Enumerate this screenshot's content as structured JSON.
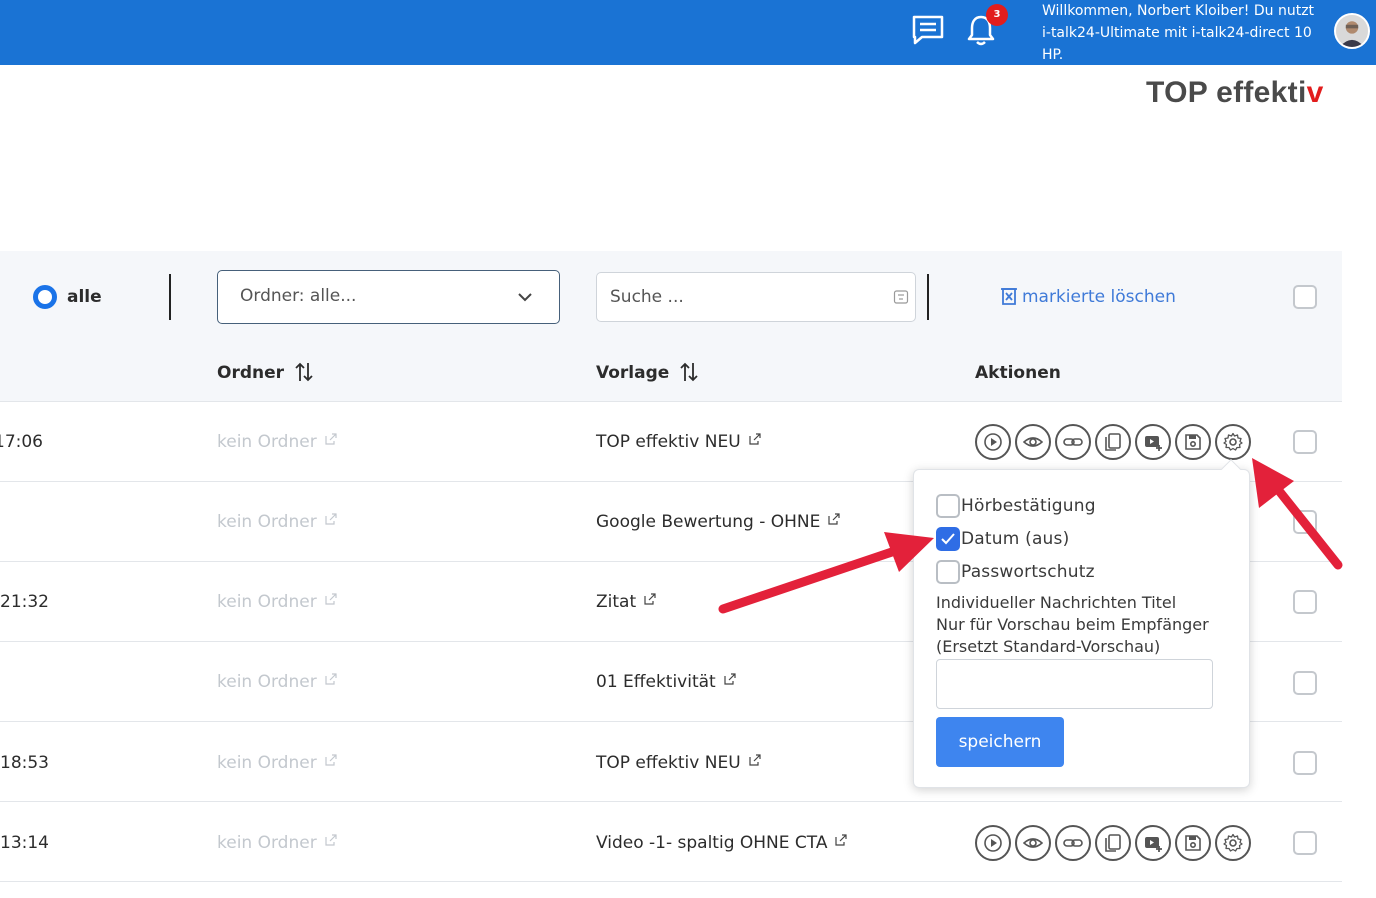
{
  "topbar": {
    "notification_count": "3",
    "welcome_text": "Willkommen, Norbert Kloiber! Du nutzt i-talk24-Ultimate mit i-talk24-direct 10 HP."
  },
  "brand": {
    "part1": "TOP effekti",
    "part2": "v"
  },
  "filters": {
    "radio_label": "alle",
    "folder_select": "Ordner: alle...",
    "search_placeholder": "Suche ...",
    "delete_marked": "markierte löschen"
  },
  "table": {
    "headers": {
      "folder": "Ordner",
      "template": "Vorlage",
      "actions": "Aktionen"
    },
    "rows": [
      {
        "time": "17:06",
        "folder": "kein Ordner",
        "template": "TOP effektiv NEU"
      },
      {
        "time": "",
        "folder": "kein Ordner",
        "template": "Google Bewertung - OHNE"
      },
      {
        "time": "21:32",
        "folder": "kein Ordner",
        "template": "Zitat"
      },
      {
        "time": "",
        "folder": "kein Ordner",
        "template": "01 Effektivität"
      },
      {
        "time": "18:53",
        "folder": "kein Ordner",
        "template": "TOP effektiv NEU"
      },
      {
        "time": "13:14",
        "folder": "kein Ordner",
        "template": "Video -1- spaltig OHNE CTA"
      }
    ]
  },
  "popover": {
    "opt1": "Hörbestätigung",
    "opt2": "Datum (aus)",
    "opt3": "Passwortschutz",
    "opt2_checked": true,
    "title_line1": "Individueller Nachrichten Titel",
    "title_line2": "Nur für Vorschau beim Empfänger",
    "title_line3": "(Ersetzt Standard-Vorschau)",
    "save_label": "speichern"
  },
  "colors": {
    "topbar": "#1a73d4",
    "accent": "#3e85ef",
    "arrow": "#e3213a",
    "badge": "#e21d1d"
  }
}
